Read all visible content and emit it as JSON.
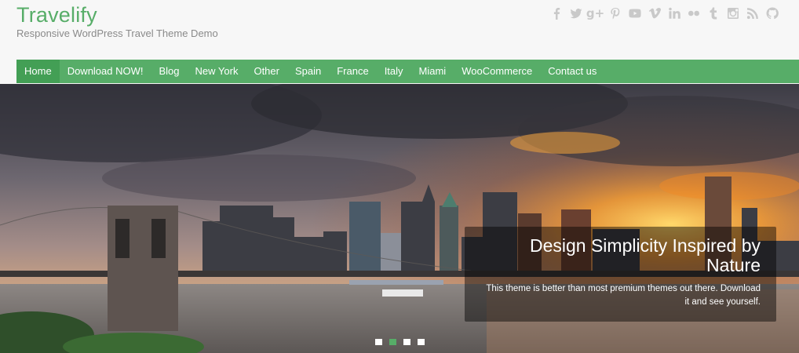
{
  "site": {
    "title": "Travelify",
    "description": "Responsive WordPress Travel Theme Demo"
  },
  "social_icons": [
    "facebook-icon",
    "twitter-icon",
    "google-plus-icon",
    "pinterest-icon",
    "youtube-icon",
    "vimeo-icon",
    "linkedin-icon",
    "flickr-icon",
    "tumblr-icon",
    "instagram-icon",
    "rss-icon",
    "github-icon"
  ],
  "nav": {
    "items": [
      {
        "label": "Home",
        "active": true
      },
      {
        "label": "Download NOW!"
      },
      {
        "label": "Blog"
      },
      {
        "label": "New York"
      },
      {
        "label": "Other"
      },
      {
        "label": "Spain"
      },
      {
        "label": "France"
      },
      {
        "label": "Italy"
      },
      {
        "label": "Miami"
      },
      {
        "label": "WooCommerce"
      },
      {
        "label": "Contact us"
      }
    ]
  },
  "slider": {
    "caption_title": "Design Simplicity Inspired by Nature",
    "caption_text": "This theme is better than most premium themes out there. Download it and see yourself.",
    "slide_count": 4,
    "active_slide": 2
  },
  "colors": {
    "accent": "#57ad68",
    "accent_dark": "#439f55",
    "muted_text": "#8a8a8a",
    "icon_grey": "#c9c9c9"
  }
}
